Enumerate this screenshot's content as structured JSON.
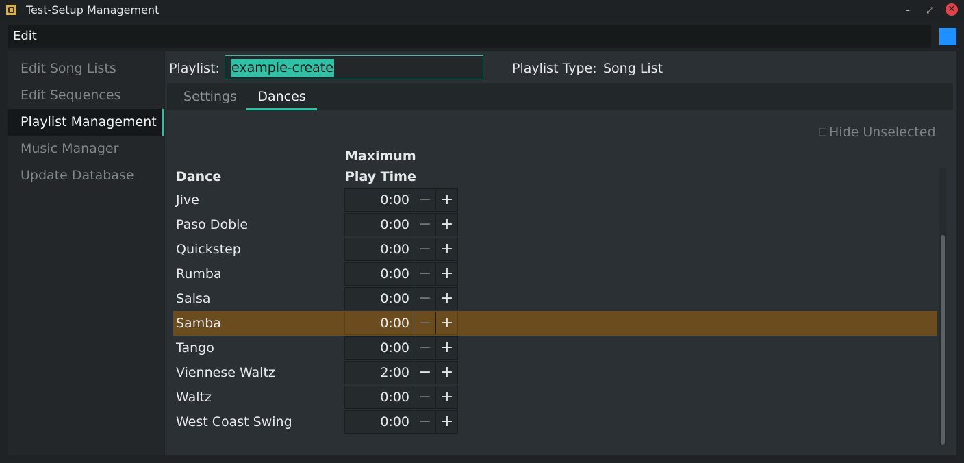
{
  "window": {
    "title": "Test-Setup Management",
    "minimize": "–",
    "restore": "⤢",
    "close": "✕"
  },
  "menubar": {
    "edit_label": "Edit"
  },
  "sidebar": {
    "items": [
      {
        "label": "Edit Song Lists"
      },
      {
        "label": "Edit Sequences"
      },
      {
        "label": "Playlist Management",
        "active": true
      },
      {
        "label": "Music Manager"
      },
      {
        "label": "Update Database"
      }
    ]
  },
  "playlist": {
    "label": "Playlist:",
    "name_value": "example-create",
    "type_label": "Playlist Type:",
    "type_value": "Song List"
  },
  "tabs": [
    {
      "label": "Settings"
    },
    {
      "label": "Dances",
      "active": true
    }
  ],
  "dances_panel": {
    "hide_unselected_label": "Hide Unselected",
    "hide_unselected_checked": false,
    "header_dance": "Dance",
    "header_max_line1": "Maximum",
    "header_max_line2": "Play Time",
    "minus_symbol": "−",
    "plus_symbol": "+",
    "rows": [
      {
        "name": "Jive",
        "time": "0:00"
      },
      {
        "name": "Paso Doble",
        "time": "0:00"
      },
      {
        "name": "Quickstep",
        "time": "0:00"
      },
      {
        "name": "Rumba",
        "time": "0:00"
      },
      {
        "name": "Salsa",
        "time": "0:00"
      },
      {
        "name": "Samba",
        "time": "0:00",
        "selected": true
      },
      {
        "name": "Tango",
        "time": "0:00"
      },
      {
        "name": "Viennese Waltz",
        "time": "2:00"
      },
      {
        "name": "Waltz",
        "time": "0:00"
      },
      {
        "name": "West Coast Swing",
        "time": "0:00"
      }
    ]
  },
  "colors": {
    "accent": "#2fc1a5",
    "selected_row": "#6b4c1e",
    "corner_square": "#1e90ff",
    "close_button": "#e0434b"
  }
}
